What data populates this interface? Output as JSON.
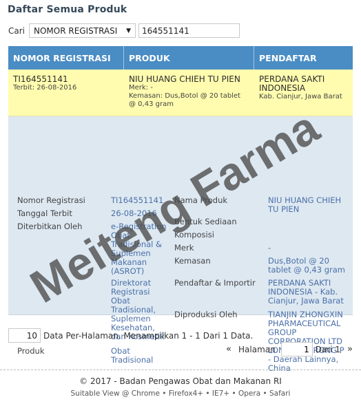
{
  "page": {
    "title": "Daftar Semua Produk"
  },
  "search": {
    "label": "Cari",
    "field_selected": "NOMOR REGISTRASI",
    "query": "164551141"
  },
  "table": {
    "headers": [
      "NOMOR REGISTRASI",
      "PRODUK",
      "PENDAFTAR"
    ],
    "row": {
      "reg_no": "TI164551141",
      "reg_date": "Terbit: 26-08-2016",
      "product_name": "NIU HUANG CHIEH TU PIEN",
      "product_merk": "Merk: -",
      "product_kemasan": "Kemasan: Dus,Botol @ 20 tablet @ 0,43 gram",
      "registrant_name": "PERDANA SAKTI INDONESIA",
      "registrant_city": "Kab. Cianjur, Jawa Barat"
    }
  },
  "detail": {
    "labels": {
      "nomor_registrasi": "Nomor Registrasi",
      "tanggal_terbit": "Tanggal Terbit",
      "diterbitkan_oleh": "Diterbitkan Oleh",
      "produk": "Produk",
      "nama_produk": "Nama Produk",
      "bentuk_sediaan": "Bentuk Sediaan",
      "komposisi": "Komposisi",
      "merk": "Merk",
      "kemasan": "Kemasan",
      "pendaftar_importir": "Pendaftar & Importir",
      "diproduksi_oleh": "Diproduksi Oleh"
    },
    "values": {
      "nomor_registrasi": "TI164551141",
      "tanggal_terbit": "26-08-2016",
      "diterbitkan_oleh_1": "e-Registration Obat Tradisional & Suplemen Makanan (ASROT)",
      "diterbitkan_oleh_2": "Direktorat Registrasi Obat Tradisional, Suplemen Kesehatan, dan Kosmetik",
      "produk": "Obat Tradisional",
      "nama_produk": "NIU HUANG CHIEH TU PIEN",
      "merk": "-",
      "kemasan": "Dus,Botol @ 20 tablet @ 0,43 gram",
      "pendaftar_importir": "PERDANA SAKTI INDONESIA - Kab. Cianjur, Jawa Barat",
      "diproduksi_oleh": "TIANJIN ZHONGXIN PHARMACEUTICAL GROUP CORPORATION LTD LONGSHUNRONG P - Daerah Lainnya, China"
    }
  },
  "watermark": {
    "text": "Meiteng Farma",
    "color": "#4a4a4a"
  },
  "pagination": {
    "per_page": "10",
    "summary": "Data Per-Halaman. Menampilkan 1 - 1 Dari 1 Data.",
    "prev_icon": "«",
    "halaman_label": "Halaman",
    "current_page": "1",
    "of_total": "Dari 1",
    "next_icon": "»"
  },
  "footer": {
    "copyright": "© 2017 - Badan Pengawas Obat dan Makanan RI",
    "suitable": "Suitable View @ Chrome • Firefox4+ • IE7+ • Opera • Safari"
  },
  "colors": {
    "header_bg": "#4a8cc4",
    "row_highlight": "#fffcaf",
    "detail_bg": "#dde8f1",
    "value_text": "#4c70a8",
    "title_text": "#35495a"
  }
}
